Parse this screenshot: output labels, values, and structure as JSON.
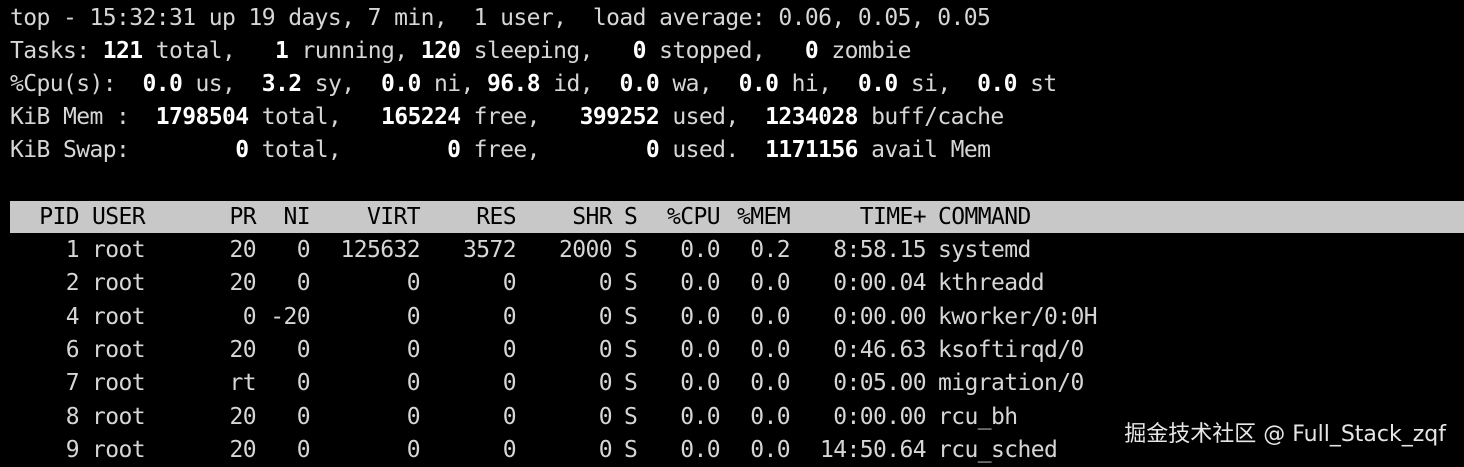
{
  "summary": {
    "line1": "top - 15:32:31 up 19 days, 7 min,  1 user,  load average: 0.06, 0.05, 0.05",
    "tasks": {
      "label": "Tasks: ",
      "total": "121",
      "total_label": " total,   ",
      "running": "1",
      "running_label": " running, ",
      "sleeping": "120",
      "sleeping_label": " sleeping,   ",
      "stopped": "0",
      "stopped_label": " stopped,   ",
      "zombie": "0",
      "zombie_label": " zombie"
    },
    "cpu": {
      "label": "%Cpu(s):  ",
      "us": "0.0",
      "us_label": " us,  ",
      "sy": "3.2",
      "sy_label": " sy,  ",
      "ni": "0.0",
      "ni_label": " ni, ",
      "id": "96.8",
      "id_label": " id,  ",
      "wa": "0.0",
      "wa_label": " wa,  ",
      "hi": "0.0",
      "hi_label": " hi,  ",
      "si": "0.0",
      "si_label": " si,  ",
      "st": "0.0",
      "st_label": " st"
    },
    "mem": {
      "label": "KiB Mem :  ",
      "total": "1798504",
      "total_label": " total,   ",
      "free": "165224",
      "free_label": " free,   ",
      "used": "399252",
      "used_label": " used,  ",
      "buff": "1234028",
      "buff_label": " buff/cache"
    },
    "swap": {
      "label": "KiB Swap:        ",
      "total": "0",
      "total_label": " total,        ",
      "free": "0",
      "free_label": " free,        ",
      "used": "0",
      "used_label": " used.  ",
      "avail": "1171156",
      "avail_label": " avail Mem"
    }
  },
  "table": {
    "columns": [
      "PID",
      "USER",
      "PR",
      "NI",
      "VIRT",
      "RES",
      "SHR",
      "S",
      "%CPU",
      "%MEM",
      "TIME+",
      "COMMAND"
    ],
    "rows": [
      [
        "1",
        "root",
        "20",
        "0",
        "125632",
        "3572",
        "2000",
        "S",
        "0.0",
        "0.2",
        "8:58.15",
        "systemd"
      ],
      [
        "2",
        "root",
        "20",
        "0",
        "0",
        "0",
        "0",
        "S",
        "0.0",
        "0.0",
        "0:00.04",
        "kthreadd"
      ],
      [
        "4",
        "root",
        "0",
        "-20",
        "0",
        "0",
        "0",
        "S",
        "0.0",
        "0.0",
        "0:00.00",
        "kworker/0:0H"
      ],
      [
        "6",
        "root",
        "20",
        "0",
        "0",
        "0",
        "0",
        "S",
        "0.0",
        "0.0",
        "0:46.63",
        "ksoftirqd/0"
      ],
      [
        "7",
        "root",
        "rt",
        "0",
        "0",
        "0",
        "0",
        "S",
        "0.0",
        "0.0",
        "0:05.00",
        "migration/0"
      ],
      [
        "8",
        "root",
        "20",
        "0",
        "0",
        "0",
        "0",
        "S",
        "0.0",
        "0.0",
        "0:00.00",
        "rcu_bh"
      ],
      [
        "9",
        "root",
        "20",
        "0",
        "0",
        "0",
        "0",
        "S",
        "0.0",
        "0.0",
        "14:50.64",
        "rcu_sched"
      ]
    ]
  },
  "watermark": "掘金技术社区 @ Full_Stack_zqf"
}
